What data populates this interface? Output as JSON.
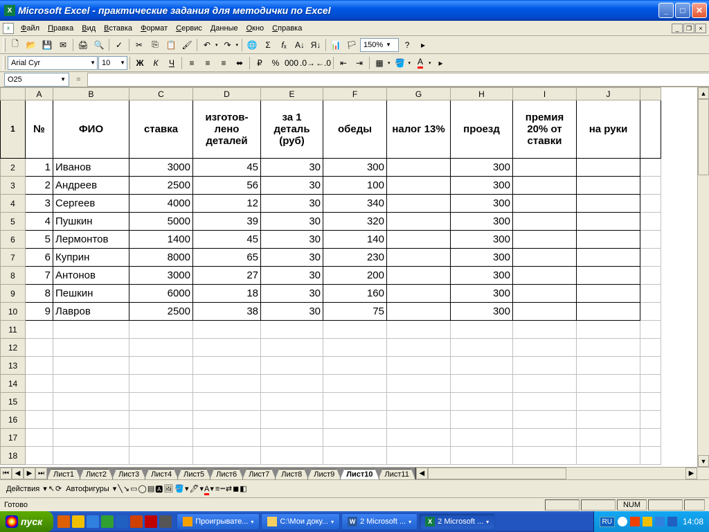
{
  "titlebar": {
    "app": "Microsoft Excel",
    "doc": "практические задания для методички по Excel"
  },
  "menu": [
    "Файл",
    "Правка",
    "Вид",
    "Вставка",
    "Формат",
    "Сервис",
    "Данные",
    "Окно",
    "Справка"
  ],
  "font": {
    "name": "Arial Cyr",
    "size": "10"
  },
  "zoom": "150%",
  "namebox": "O25",
  "formula": "=",
  "columns": [
    "A",
    "B",
    "C",
    "D",
    "E",
    "F",
    "G",
    "H",
    "I",
    "J"
  ],
  "headers": {
    "A": "№",
    "B": "ФИО",
    "C": "ставка",
    "D": "изготов-\nлено деталей",
    "E": "за 1 деталь (руб)",
    "F": "обеды",
    "G": "налог 13%",
    "H": "проезд",
    "I": "премия 20% от ставки",
    "J": "на руки"
  },
  "rows": [
    {
      "n": "1",
      "fio": "Иванов",
      "stavka": "3000",
      "izg": "45",
      "za1": "30",
      "obedy": "300",
      "nalog": "",
      "proezd": "300",
      "premia": "",
      "naruki": ""
    },
    {
      "n": "2",
      "fio": "Андреев",
      "stavka": "2500",
      "izg": "56",
      "za1": "30",
      "obedy": "100",
      "nalog": "",
      "proezd": "300",
      "premia": "",
      "naruki": ""
    },
    {
      "n": "3",
      "fio": "Сергеев",
      "stavka": "4000",
      "izg": "12",
      "za1": "30",
      "obedy": "340",
      "nalog": "",
      "proezd": "300",
      "premia": "",
      "naruki": ""
    },
    {
      "n": "4",
      "fio": "Пушкин",
      "stavka": "5000",
      "izg": "39",
      "za1": "30",
      "obedy": "320",
      "nalog": "",
      "proezd": "300",
      "premia": "",
      "naruki": ""
    },
    {
      "n": "5",
      "fio": "Лермонтов",
      "stavka": "1400",
      "izg": "45",
      "za1": "30",
      "obedy": "140",
      "nalog": "",
      "proezd": "300",
      "premia": "",
      "naruki": ""
    },
    {
      "n": "6",
      "fio": "Куприн",
      "stavka": "8000",
      "izg": "65",
      "za1": "30",
      "obedy": "230",
      "nalog": "",
      "proezd": "300",
      "premia": "",
      "naruki": ""
    },
    {
      "n": "7",
      "fio": "Антонов",
      "stavka": "3000",
      "izg": "27",
      "za1": "30",
      "obedy": "200",
      "nalog": "",
      "proezd": "300",
      "premia": "",
      "naruki": ""
    },
    {
      "n": "8",
      "fio": "Пешкин",
      "stavka": "6000",
      "izg": "18",
      "za1": "30",
      "obedy": "160",
      "nalog": "",
      "proezd": "300",
      "premia": "",
      "naruki": ""
    },
    {
      "n": "9",
      "fio": "Лавров",
      "stavka": "2500",
      "izg": "38",
      "za1": "30",
      "obedy": "75",
      "nalog": "",
      "proezd": "300",
      "premia": "",
      "naruki": ""
    }
  ],
  "empty_rows": [
    11,
    12,
    13,
    14,
    15,
    16,
    17,
    18
  ],
  "sheets": [
    "Лист1",
    "Лист2",
    "Лист3",
    "Лист4",
    "Лист5",
    "Лист6",
    "Лист7",
    "Лист8",
    "Лист9",
    "Лист10",
    "Лист11"
  ],
  "active_sheet": 9,
  "draw": {
    "actions": "Действия",
    "autoshapes": "Автофигуры"
  },
  "status": {
    "ready": "Готово",
    "num": "NUM"
  },
  "taskbar": {
    "start": "пуск",
    "tasks": [
      {
        "label": "Проигрывате...",
        "icon": "#f5a000"
      },
      {
        "label": "С:\\Мои доку...",
        "icon": "#f5d060"
      },
      {
        "label": "2 Microsoft ...",
        "icon": "#2b579a",
        "prefix": "W"
      },
      {
        "label": "2 Microsoft ...",
        "icon": "#107c41",
        "prefix": "X",
        "active": true
      }
    ],
    "lang": "RU",
    "clock": "14:08"
  }
}
